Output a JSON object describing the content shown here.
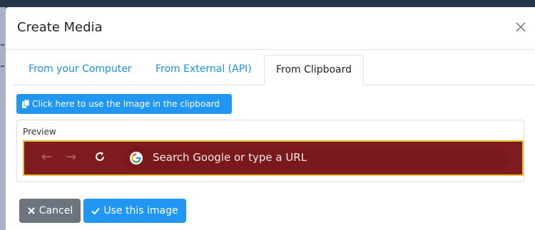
{
  "modal": {
    "title": "Create Media"
  },
  "tabs": [
    {
      "label": "From your Computer"
    },
    {
      "label": "From External (API)"
    },
    {
      "label": "From Clipboard"
    }
  ],
  "active_tab": "From Clipboard",
  "clipboard_button": {
    "label": "Click here to use the Image in the clipboard"
  },
  "preview": {
    "label": "Preview",
    "image": {
      "browser_bar_color": "#7f1c1f",
      "border_color": "#e6c12f",
      "omnibox_text": "Search Google or type a URL"
    }
  },
  "footer": {
    "cancel_label": "Cancel",
    "use_label": "Use this image"
  },
  "colors": {
    "primary": "#2196f3",
    "secondary": "#6c757d",
    "tab_link": "#1a8fe3"
  }
}
